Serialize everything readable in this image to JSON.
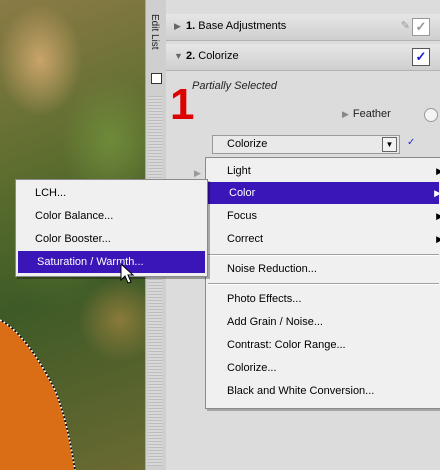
{
  "panel": {
    "base_adjustments": {
      "number": "1.",
      "label": "Base Adjustments"
    },
    "colorize_section": {
      "number": "2.",
      "label": "Colorize",
      "checked": true
    },
    "partially_selected": "Partially Selected",
    "step_number": "1",
    "feather_label": "Feather",
    "colorize_select_value": "Colorize"
  },
  "edit_strip": {
    "label": "Edit List"
  },
  "menu": {
    "items": [
      {
        "label": "Light",
        "has_submenu": true
      },
      {
        "label": "Color",
        "has_submenu": true,
        "active": true
      },
      {
        "label": "Focus",
        "has_submenu": true
      },
      {
        "label": "Correct",
        "has_submenu": true
      },
      {
        "label": "Noise Reduction..."
      },
      {
        "label": "Photo Effects..."
      },
      {
        "label": "Add Grain / Noise..."
      },
      {
        "label": "Contrast: Color Range..."
      },
      {
        "label": "Colorize..."
      },
      {
        "label": "Black and White Conversion..."
      }
    ]
  },
  "submenu": {
    "items": [
      {
        "label": "LCH..."
      },
      {
        "label": "Color Balance..."
      },
      {
        "label": "Color Booster..."
      },
      {
        "label": "Saturation / Warmth...",
        "active": true
      }
    ]
  },
  "colors": {
    "menu_highlight": "#3a16b8",
    "annotation_red": "#dd0000",
    "check_blue": "#1a1acc"
  }
}
